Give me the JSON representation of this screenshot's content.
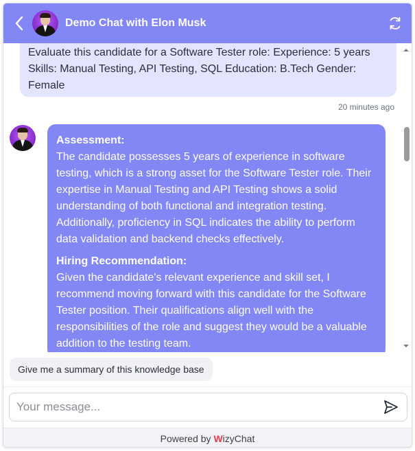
{
  "header": {
    "title": "Demo Chat with Elon Musk",
    "back_icon": "chevron-left-icon",
    "refresh_icon": "refresh-icon"
  },
  "messages": {
    "user": {
      "text": "Evaluate this candidate for a Software Tester role: Experience: 5 years Skills: Manual Testing, API Testing, SQL Education: B.Tech Gender: Female",
      "timestamp": "20 minutes ago"
    },
    "bot": {
      "heading1": "Assessment:",
      "para1": "The candidate possesses 5 years of experience in software testing, which is a strong asset for the Software Tester role. Their expertise in Manual Testing and API Testing shows a solid understanding of both functional and integration testing. Additionally, proficiency in SQL indicates the ability to perform data validation and backend checks effectively.",
      "heading2": "Hiring Recommendation:",
      "para2": "Given the candidate's relevant experience and skill set, I recommend moving forward with this candidate for the Software Tester position. Their qualifications align well with the responsibilities of the role and suggest they would be a valuable addition to the testing team."
    }
  },
  "suggestion": {
    "label": "Give me a summary of this knowledge base"
  },
  "composer": {
    "placeholder": "Your message...",
    "send_icon": "send-icon"
  },
  "footer": {
    "powered_by": "Powered by",
    "brand_first": "W",
    "brand_rest": "izyChat"
  },
  "colors": {
    "accent": "#8287f5",
    "user_bubble": "#e2e5fd",
    "brand": "#e33a4f"
  }
}
